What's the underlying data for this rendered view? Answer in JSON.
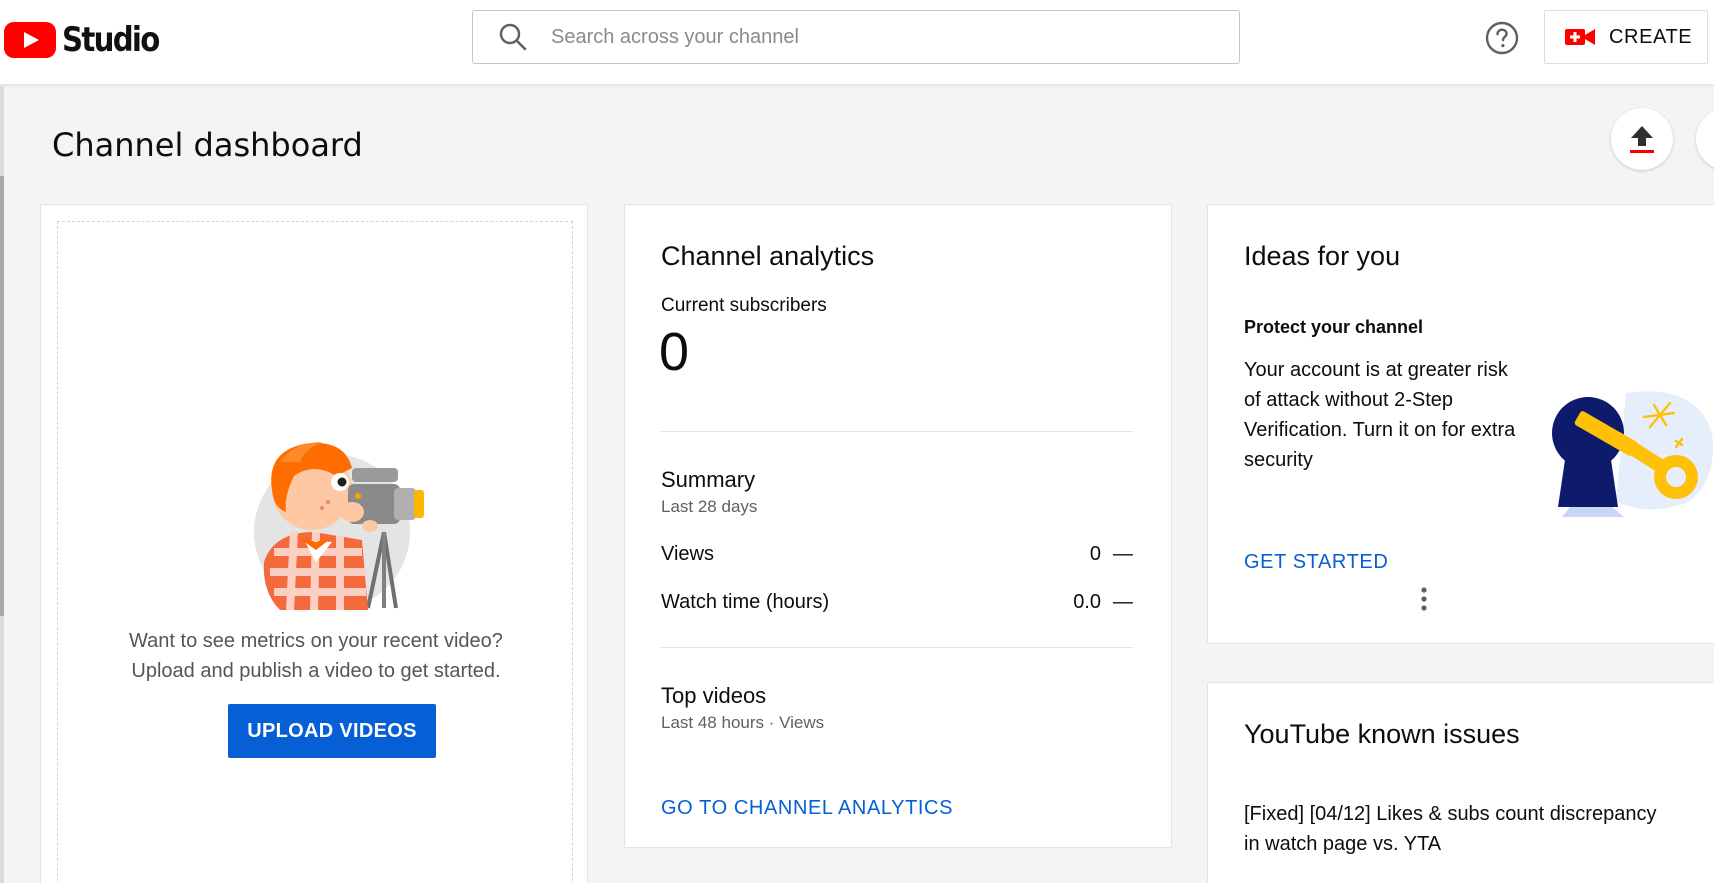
{
  "app": {
    "logo_text": "Studio"
  },
  "header": {
    "search_placeholder": "Search across your channel",
    "create_label": "CREATE"
  },
  "page": {
    "title": "Channel dashboard"
  },
  "upload_card": {
    "message_line1": "Want to see metrics on your recent video?",
    "message_line2": "Upload and publish a video to get started.",
    "button_label": "UPLOAD VIDEOS"
  },
  "analytics_card": {
    "title": "Channel analytics",
    "subscribers_label": "Current subscribers",
    "subscribers_value": "0",
    "summary_title": "Summary",
    "summary_period": "Last 28 days",
    "stats": [
      {
        "name": "Views",
        "value": "0",
        "trend": "—"
      },
      {
        "name": "Watch time (hours)",
        "value": "0.0",
        "trend": "—"
      }
    ],
    "top_videos_title": "Top videos",
    "top_videos_period": "Last 48 hours · Views",
    "link_label": "GO TO CHANNEL ANALYTICS"
  },
  "ideas_card": {
    "title": "Ideas for you",
    "idea_title": "Protect your channel",
    "idea_body": "Your account is at greater risk of attack without 2-Step Verification. Turn it on for extra security",
    "action_label": "GET STARTED"
  },
  "issues_card": {
    "title": "YouTube known issues",
    "issue_text": "[Fixed] [04/12] Likes & subs count discrepancy in watch page vs. YTA"
  },
  "colors": {
    "brand_red": "#ff0000",
    "link_blue": "#065fd4",
    "background": "#f4f4f4"
  }
}
